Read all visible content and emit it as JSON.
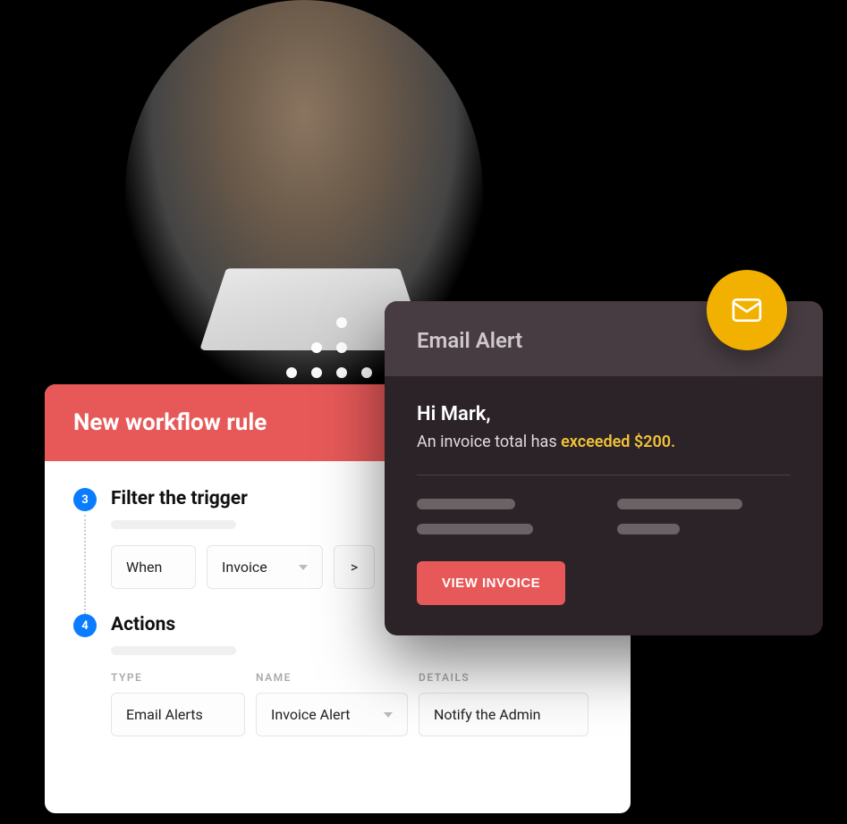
{
  "workflow": {
    "title": "New workflow rule",
    "steps": [
      {
        "num": "3",
        "title": "Filter the trigger",
        "filter": {
          "when": "When",
          "field": "Invoice",
          "op": ">"
        }
      },
      {
        "num": "4",
        "title": "Actions",
        "columns": {
          "type": "TYPE",
          "name": "NAME",
          "details": "DETAILS"
        },
        "action": {
          "type": "Email Alerts",
          "name": "Invoice Alert",
          "details": "Notify the Admin"
        }
      }
    ]
  },
  "alert": {
    "header": "Email Alert",
    "greeting": "Hi Mark,",
    "message_prefix": "An invoice total has ",
    "message_highlight": "exceeded $200.",
    "button": "VIEW INVOICE",
    "badge_icon": "mail-icon"
  }
}
